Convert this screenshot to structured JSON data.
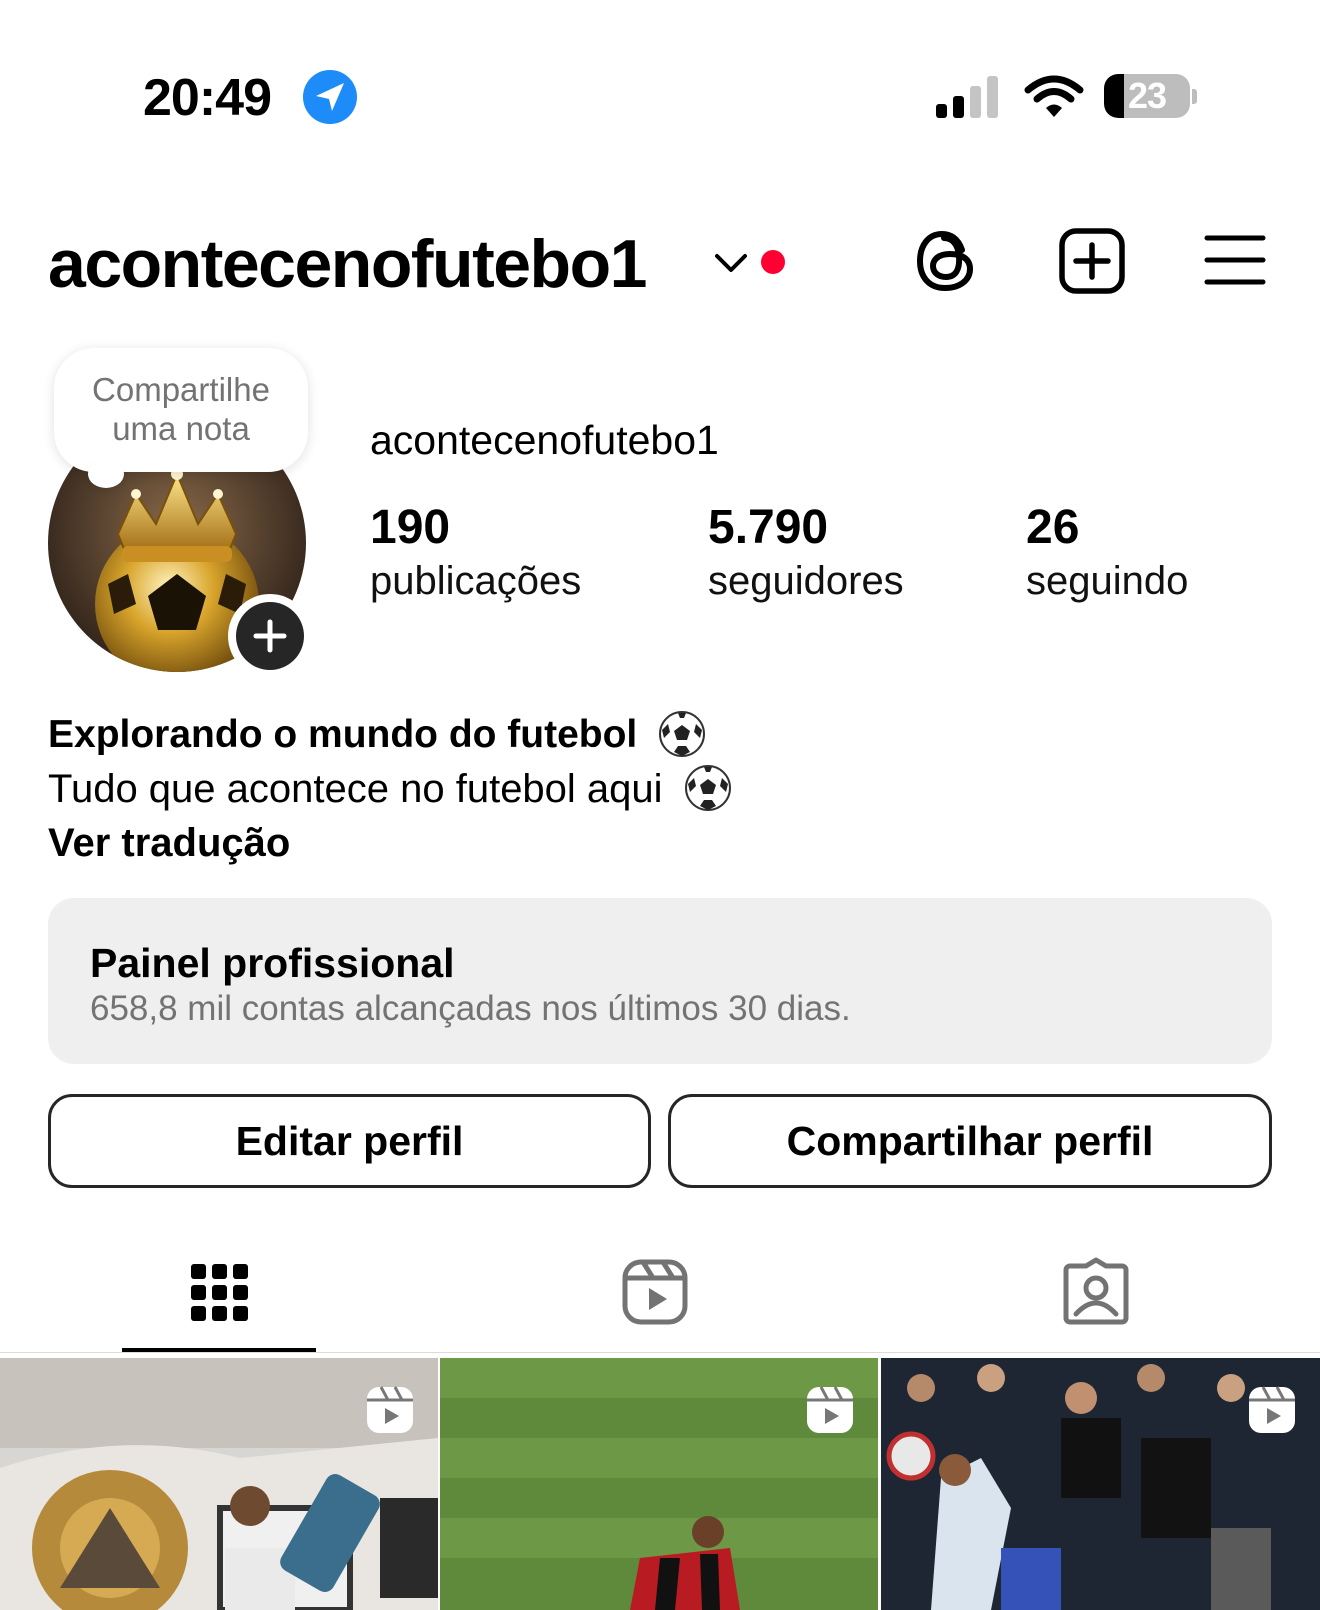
{
  "status_bar": {
    "time": "20:49",
    "battery_level": "23",
    "battery_fraction": 0.23,
    "icons": [
      "location-arrow-icon",
      "cellular-signal-icon",
      "wifi-icon",
      "battery-icon"
    ]
  },
  "header": {
    "username": "acontecenofutebo1",
    "has_notification_dot": true,
    "notification_color": "#ff0033",
    "icons": [
      "chevron-down-icon",
      "threads-icon",
      "create-plus-icon",
      "menu-icon"
    ]
  },
  "note": {
    "line1": "Compartilhe",
    "line2": "uma nota"
  },
  "profile": {
    "name": "acontecenofutebo1",
    "stats": [
      {
        "value": "190",
        "label": "publicações"
      },
      {
        "value": "5.790",
        "label": "seguidores"
      },
      {
        "value": "26",
        "label": "seguindo"
      }
    ]
  },
  "bio": {
    "title": "Explorando o mundo do futebol",
    "text": "Tudo que acontece no futebol aqui",
    "translate": "Ver tradução"
  },
  "dashboard": {
    "title": "Painel profissional",
    "subtitle": "658,8 mil contas alcançadas nos últimos 30 dias."
  },
  "buttons": {
    "edit": "Editar perfil",
    "share": "Compartilhar perfil"
  },
  "tabs": [
    {
      "icon": "grid-icon",
      "active": true
    },
    {
      "icon": "reels-icon",
      "active": false
    },
    {
      "icon": "tagged-icon",
      "active": false
    }
  ],
  "colors": {
    "accent_blue": "#1d8cf8",
    "notification_red": "#ff0033",
    "secondary_text": "#737373",
    "dashboard_bg": "#efefef"
  }
}
